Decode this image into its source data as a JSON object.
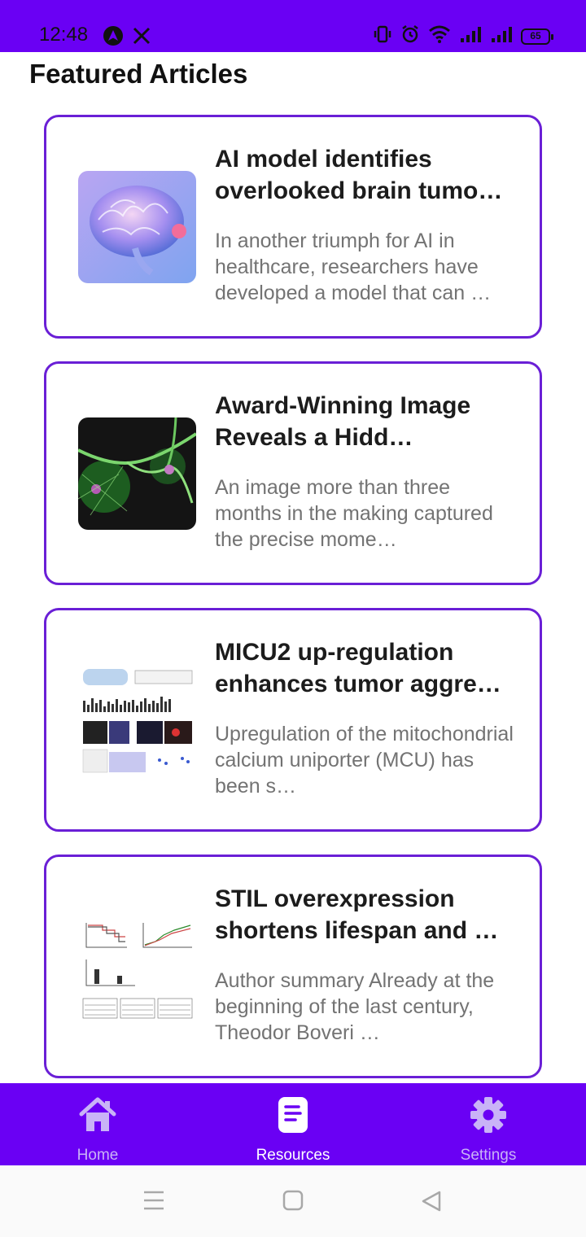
{
  "status_bar": {
    "time": "12:48",
    "battery": "65",
    "background_color": "#6a00f4"
  },
  "header": {
    "title": "Featured Articles"
  },
  "articles": [
    {
      "title": "AI model identifies overlooked brain tumo…",
      "description": "In another triumph for AI in healthcare, researchers have developed a model that can …",
      "thumbnail": "brain-illustration"
    },
    {
      "title": "Award-Winning Image Reveals a Hidd…",
      "description": "An image more than three months in the making captured the precise mome…",
      "thumbnail": "neuron-microscopy"
    },
    {
      "title": "MICU2 up-regulation enhances tumor aggre…",
      "description": "Upregulation of the mitochondrial calcium uniporter (MCU) has been s…",
      "thumbnail": "scientific-figure-panels"
    },
    {
      "title": "STIL overexpression shortens lifespan and …",
      "description": "Author summary Already at the beginning of the last century, Theodor Boveri …",
      "thumbnail": "scientific-figure-plots"
    }
  ],
  "bottom_nav": {
    "items": [
      {
        "label": "Home",
        "icon": "home-icon",
        "active": false
      },
      {
        "label": "Resources",
        "icon": "document-icon",
        "active": true
      },
      {
        "label": "Settings",
        "icon": "gear-icon",
        "active": false
      }
    ]
  },
  "colors": {
    "accent": "#6a00f4",
    "card_border": "#6a1fd6"
  }
}
